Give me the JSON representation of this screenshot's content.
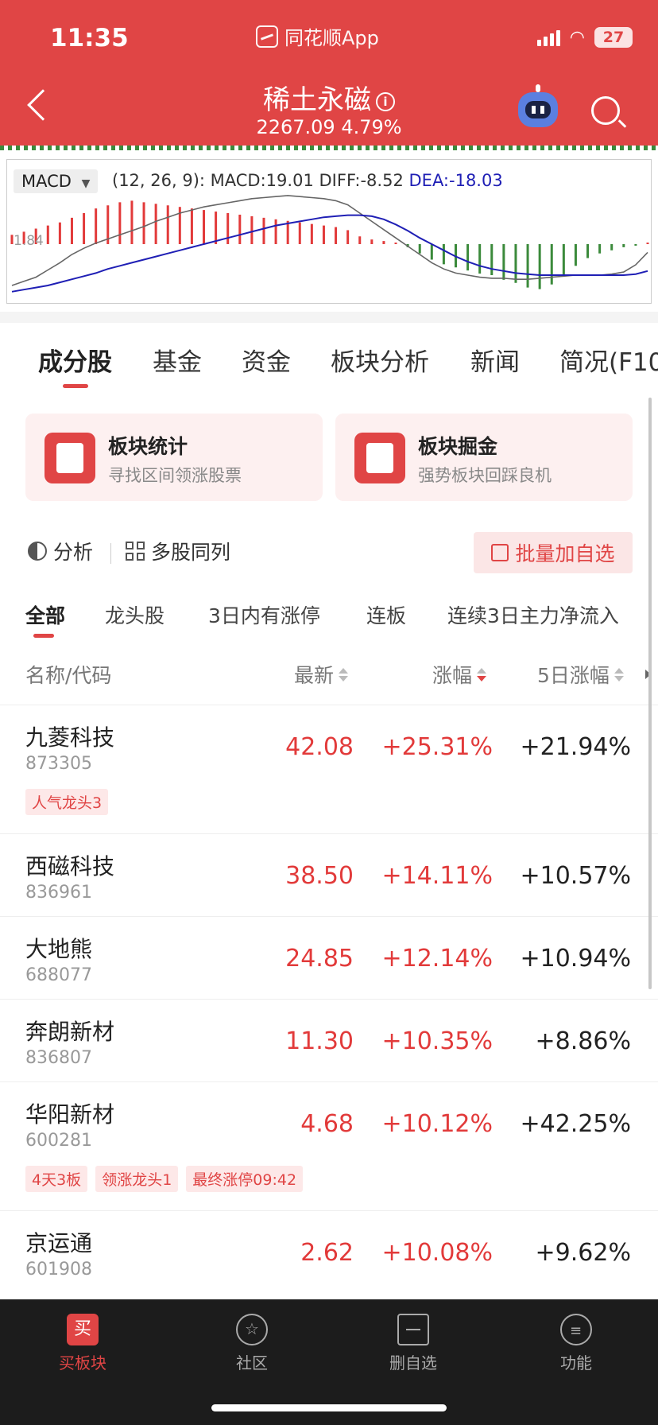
{
  "status_bar": {
    "time": "11:35",
    "app": "同花顺App",
    "battery": "27"
  },
  "header": {
    "title": "稀土永磁",
    "subtitle": "2267.09 4.79%"
  },
  "chart": {
    "indicator": "MACD",
    "params": "(12, 26, 9):",
    "macd": "MACD:19.01",
    "diff": "DIFF:-8.52",
    "dea": "DEA:-18.03",
    "y_label": "1.84"
  },
  "chart_data": {
    "type": "line",
    "title": "MACD (12, 26, 9)",
    "series": [
      {
        "name": "DIFF",
        "values": [
          -40,
          -36,
          -32,
          -25,
          -18,
          -10,
          -4,
          1,
          5,
          9,
          13,
          17,
          22,
          26,
          30,
          33,
          36,
          38,
          40,
          42,
          44,
          45,
          46,
          47,
          46,
          45,
          44,
          42,
          38,
          30,
          22,
          14,
          6,
          -2,
          -10,
          -18,
          -24,
          -28,
          -30,
          -32,
          -33,
          -33,
          -34,
          -34,
          -33,
          -32,
          -31,
          -30,
          -30,
          -30,
          -29,
          -27,
          -20,
          -8
        ]
      },
      {
        "name": "DEA",
        "values": [
          -46,
          -44,
          -42,
          -40,
          -37,
          -34,
          -31,
          -28,
          -24,
          -21,
          -18,
          -15,
          -12,
          -9,
          -6,
          -3,
          0,
          3,
          6,
          9,
          12,
          15,
          18,
          20,
          22,
          24,
          26,
          27,
          28,
          28,
          27,
          24,
          19,
          13,
          6,
          0,
          -6,
          -12,
          -17,
          -21,
          -24,
          -26,
          -28,
          -29,
          -30,
          -30,
          -30,
          -30,
          -30,
          -30,
          -30,
          -30,
          -29,
          -26
        ]
      },
      {
        "name": "MACD",
        "values": [
          12,
          16,
          20,
          24,
          28,
          34,
          40,
          46,
          50,
          54,
          56,
          54,
          52,
          50,
          48,
          46,
          44,
          42,
          40,
          38,
          36,
          34,
          32,
          30,
          28,
          26,
          24,
          22,
          18,
          10,
          6,
          4,
          2,
          -4,
          -12,
          -20,
          -26,
          -30,
          -34,
          -38,
          -40,
          -46,
          -50,
          -56,
          -58,
          -52,
          -40,
          -28,
          -18,
          -12,
          -8,
          -4,
          -2,
          2
        ]
      }
    ],
    "grid": false
  },
  "main_tabs": [
    "成分股",
    "基金",
    "资金",
    "板块分析",
    "新闻",
    "简况(F10"
  ],
  "cards": [
    {
      "title": "板块统计",
      "sub": "寻找区间领涨股票"
    },
    {
      "title": "板块掘金",
      "sub": "强势板块回踩良机"
    }
  ],
  "actions": {
    "analysis": "分析",
    "multi": "多股同列",
    "batch": "批量加自选"
  },
  "filter_tabs": [
    "全部",
    "龙头股",
    "3日内有涨停",
    "连板",
    "连续3日主力净流入"
  ],
  "table": {
    "headers": {
      "name": "名称/代码",
      "latest": "最新",
      "change": "涨幅",
      "five_day": "5日涨幅"
    },
    "rows": [
      {
        "name": "九菱科技",
        "code": "873305",
        "latest": "42.08",
        "change": "+25.31%",
        "five_day": "+21.94%",
        "tags": [
          "人气龙头3"
        ]
      },
      {
        "name": "西磁科技",
        "code": "836961",
        "latest": "38.50",
        "change": "+14.11%",
        "five_day": "+10.57%",
        "tags": []
      },
      {
        "name": "大地熊",
        "code": "688077",
        "latest": "24.85",
        "change": "+12.14%",
        "five_day": "+10.94%",
        "tags": []
      },
      {
        "name": "奔朗新材",
        "code": "836807",
        "latest": "11.30",
        "change": "+10.35%",
        "five_day": "+8.86%",
        "tags": []
      },
      {
        "name": "华阳新材",
        "code": "600281",
        "latest": "4.68",
        "change": "+10.12%",
        "five_day": "+42.25%",
        "tags": [
          "4天3板",
          "领涨龙头1",
          "最终涨停09:42"
        ]
      },
      {
        "name": "京运通",
        "code": "601908",
        "latest": "2.62",
        "change": "+10.08%",
        "five_day": "+9.62%",
        "tags": []
      }
    ]
  },
  "bottom_nav": [
    {
      "label": "买板块",
      "icon": "买"
    },
    {
      "label": "社区",
      "icon": ""
    },
    {
      "label": "删自选",
      "icon": ""
    },
    {
      "label": "功能",
      "icon": ""
    }
  ],
  "colors": {
    "brand": "#e04545",
    "up": "#e23a3a",
    "down": "#3b8a3b",
    "dea": "#1f1fb5"
  }
}
